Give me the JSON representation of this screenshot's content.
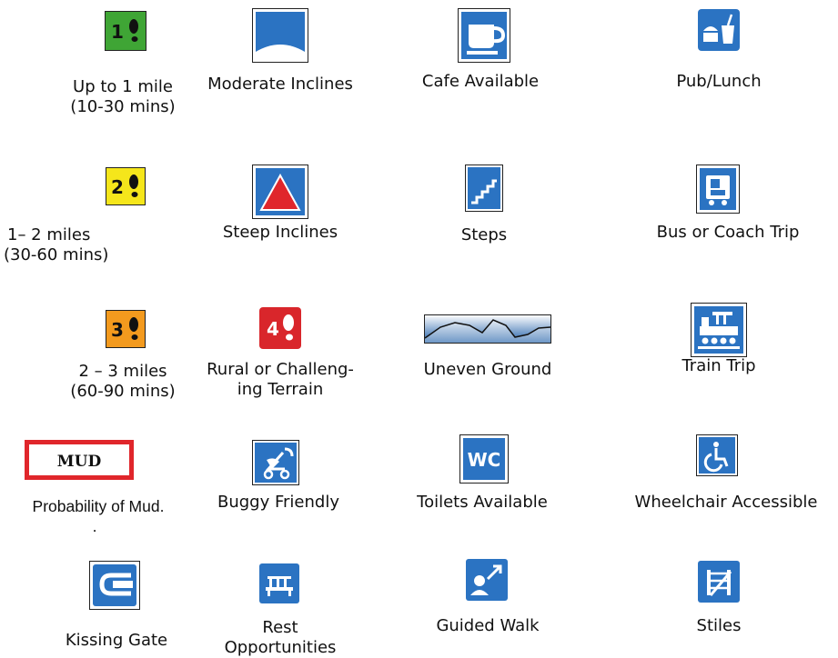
{
  "legend": {
    "row1": {
      "distance_1": {
        "badge": "1",
        "line1": "Up to 1 mile",
        "line2": "(10-30 mins)",
        "color": "#3fa535"
      },
      "moderate_inclines": {
        "label": "Moderate Inclines"
      },
      "cafe": {
        "label": "Cafe Available"
      },
      "pub": {
        "label": "Pub/Lunch"
      }
    },
    "row2": {
      "distance_2": {
        "badge": "2",
        "line1": "1– 2 miles",
        "line2": "(30-60 mins)",
        "color": "#f5e61b"
      },
      "steep_inclines": {
        "label": "Steep Inclines"
      },
      "steps": {
        "label": "Steps"
      },
      "bus": {
        "label": "Bus or Coach Trip"
      }
    },
    "row3": {
      "distance_3": {
        "badge": "3",
        "line1": "2 – 3 miles",
        "line2": "(60-90 mins)",
        "color": "#f39a1e"
      },
      "rural": {
        "badge": "4",
        "line1": "Rural or Challeng-",
        "line2": "ing Terrain",
        "color": "#d9262b"
      },
      "uneven": {
        "label": "Uneven Ground"
      },
      "train": {
        "label": "Train Trip"
      }
    },
    "row4": {
      "mud": {
        "sign": "MUD",
        "label": "Probability of Mud.",
        "dot": "."
      },
      "buggy": {
        "label": "Buggy Friendly"
      },
      "toilets": {
        "sign": "WC",
        "label": "Toilets Available"
      },
      "wheelchair": {
        "label": "Wheelchair Accessible"
      }
    },
    "row5": {
      "kissing_gate": {
        "label": "Kissing Gate"
      },
      "rest": {
        "line1": "Rest",
        "line2": "Opportunities"
      },
      "guided": {
        "label": "Guided Walk"
      },
      "stiles": {
        "label": "Stiles"
      }
    }
  },
  "colors": {
    "icon_blue": "#2b73c2",
    "frame": "#1a1a1a",
    "mud_red": "#e0262b"
  }
}
